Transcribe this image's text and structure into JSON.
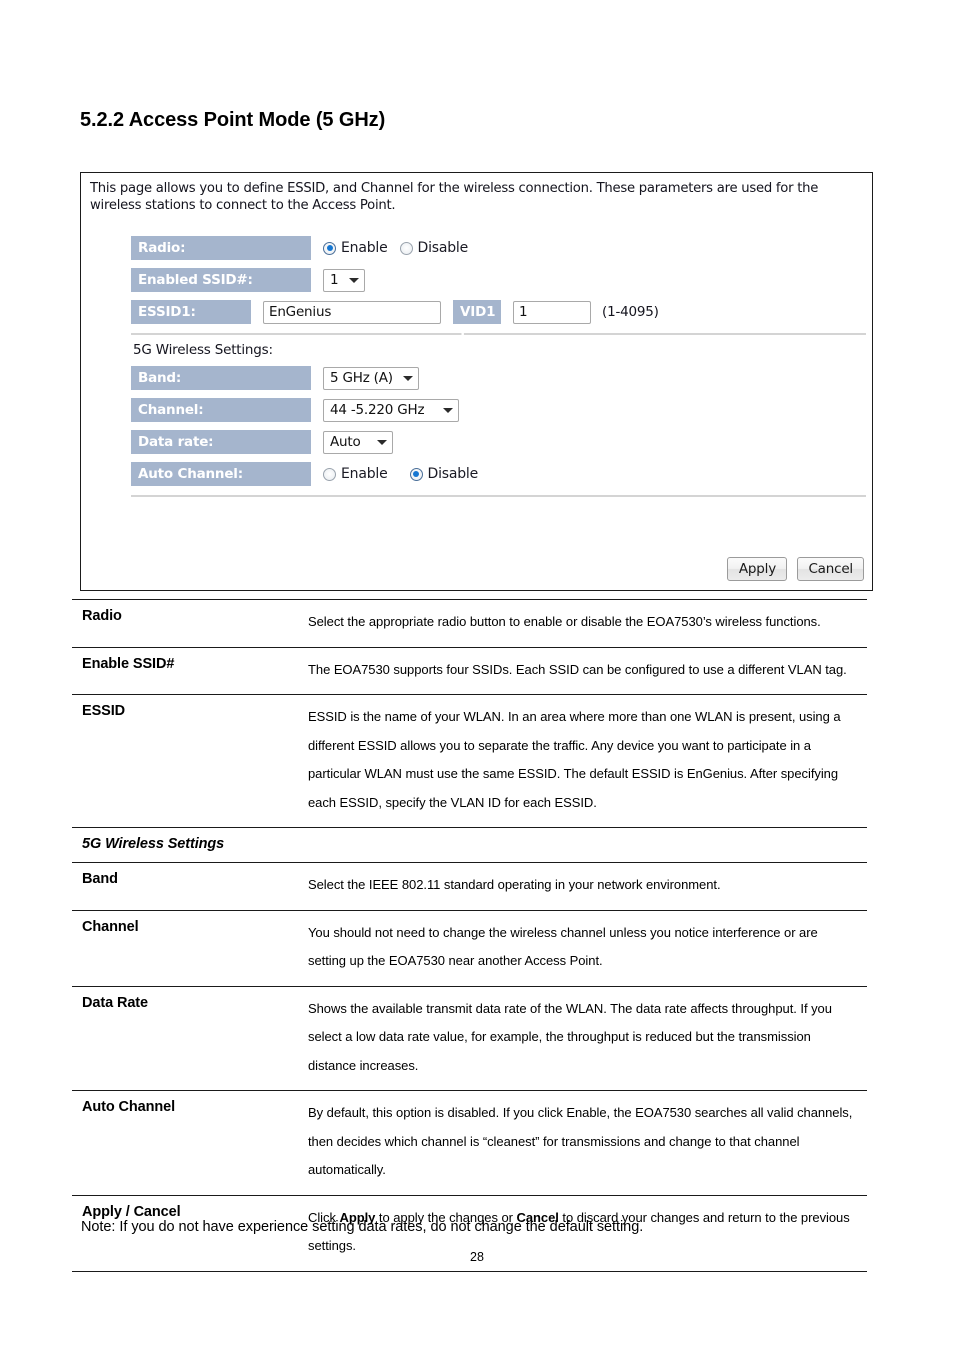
{
  "heading": "5.2.2 Access Point Mode (5 GHz)",
  "ui_panel": {
    "description": "This page allows you to define ESSID, and Channel for the wireless connection. These parameters are used for the wireless stations to connect to the Access Point.",
    "radio": {
      "label": "Radio:",
      "enable_label": "Enable",
      "disable_label": "Disable",
      "selected": "Enable"
    },
    "enabled_ssid": {
      "label": "Enabled SSID#:",
      "value": "1"
    },
    "essid1": {
      "label": "ESSID1:",
      "value": "EnGenius",
      "vid_label": "VID1 :",
      "vid_value": "1",
      "vid_hint": "(1-4095)"
    },
    "wireless_section_label": "5G Wireless Settings:",
    "band": {
      "label": "Band:",
      "value": "5 GHz (A)"
    },
    "channel": {
      "label": "Channel:",
      "value": "44 -5.220 GHz"
    },
    "data_rate": {
      "label": "Data rate:",
      "value": "Auto"
    },
    "auto_channel": {
      "label": "Auto Channel:",
      "enable_label": "Enable",
      "disable_label": "Disable",
      "selected": "Disable"
    },
    "buttons": {
      "apply": "Apply",
      "cancel": "Cancel"
    },
    "colors": {
      "label_cell_bg": "#a5b5cd",
      "label_cell_text": "#ffffff",
      "radio_accent": "#1677d2",
      "panel_border": "#1b1b1b"
    }
  },
  "desc_table": {
    "rows": [
      {
        "term": "Radio",
        "def": "Select the appropriate radio button to enable or disable the EOA7530’s wireless functions.",
        "is_section": false
      },
      {
        "term": "Enable SSID#",
        "def": "The EOA7530 supports four SSIDs. Each SSID can be configured to use a different VLAN tag.",
        "is_section": false
      },
      {
        "term": "ESSID",
        "def": "ESSID is the name of your WLAN. In an area where more than one WLAN is present, using a different ESSID allows you to separate the traffic. Any device you want to participate in a particular WLAN must use the same ESSID. The default ESSID is EnGenius. After specifying each ESSID, specify the VLAN ID for each ESSID.",
        "is_section": false
      },
      {
        "term": "5G Wireless Settings",
        "def": "",
        "is_section": true
      },
      {
        "term": "Band",
        "def": "Select the IEEE 802.11 standard operating in your network environment.",
        "is_section": false
      },
      {
        "term": "Channel",
        "def": "You should not need to change the wireless channel unless you notice interference or are setting up the EOA7530 near another Access Point.",
        "is_section": false
      },
      {
        "term": "Data Rate",
        "def": "Shows the available transmit data rate of the WLAN. The data rate affects throughput. If you select a low data rate value, for example, the throughput is reduced but the transmission distance increases.",
        "is_section": false
      },
      {
        "term": "Auto Channel",
        "def": "By default, this option is disabled. If you click Enable, the EOA7530 searches all valid channels, then decides which channel is “cleanest” for transmissions and change to that channel automatically.",
        "is_section": false
      },
      {
        "term": "Apply / Cancel",
        "def": "Click Apply to apply the changes or Cancel to discard your changes and return to the previous settings.",
        "def_bold_words": [
          "Apply",
          "Cancel"
        ],
        "is_section": false
      }
    ]
  },
  "footer": {
    "note": "Note: If you do not have experience setting data rates, do not change the default setting.",
    "page_number": "28"
  }
}
